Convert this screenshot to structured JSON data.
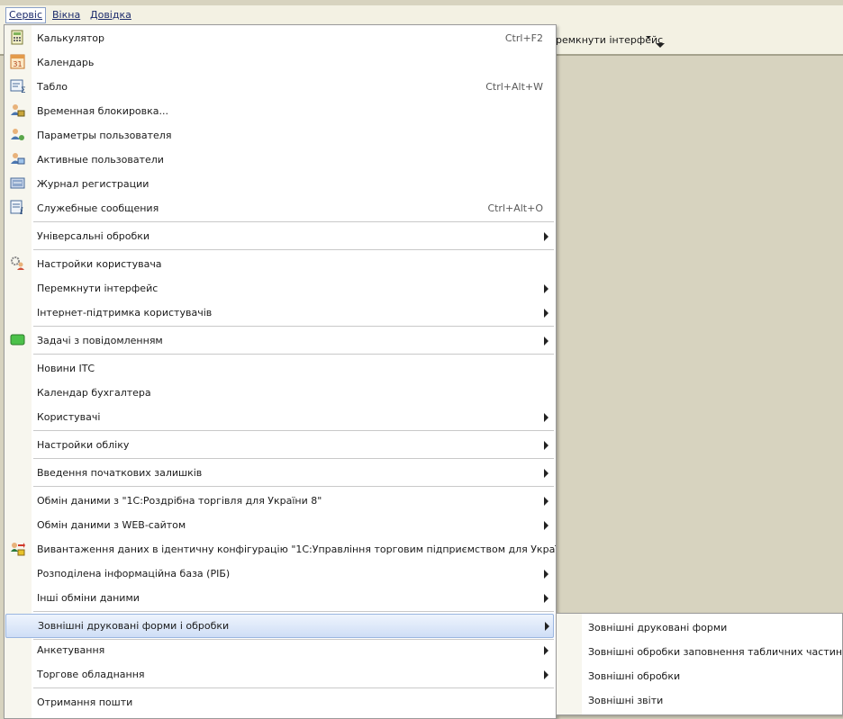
{
  "menubar": {
    "items": [
      "Сервіс",
      "Вікна",
      "Довідка"
    ]
  },
  "toolbar": {
    "partial_text": "ремкнути інтерфейс"
  },
  "menu": {
    "items": [
      {
        "label": "Калькулятор",
        "shortcut": "Ctrl+F2",
        "icon": "calculator-icon"
      },
      {
        "label": "Календарь",
        "shortcut": "",
        "icon": "calendar-icon",
        "icon_text": "31"
      },
      {
        "label": "Табло",
        "shortcut": "Ctrl+Alt+W",
        "icon": "tablo-icon"
      },
      {
        "label": "Временная блокировка...",
        "shortcut": "",
        "icon": "user-lock-icon"
      },
      {
        "label": "Параметры пользователя",
        "shortcut": "",
        "icon": "user-settings-icon"
      },
      {
        "label": "Активные пользователи",
        "shortcut": "",
        "icon": "active-users-icon"
      },
      {
        "label": "Журнал регистрации",
        "shortcut": "",
        "icon": "journal-icon"
      },
      {
        "label": "Служебные сообщения",
        "shortcut": "Ctrl+Alt+O",
        "icon": "messages-icon"
      },
      {
        "label": "Універсальні обробки"
      },
      {
        "label": "Настройки користувача",
        "icon": "user-gear-icon"
      },
      {
        "label": "Перемкнути інтерфейс"
      },
      {
        "label": "Інтернет-підтримка користувачів"
      },
      {
        "label": "Задачі з повідомленням",
        "icon": "task-message-icon"
      },
      {
        "label": "Новини ІТС"
      },
      {
        "label": "Календар бухгалтера"
      },
      {
        "label": "Користувачі"
      },
      {
        "label": "Настройки обліку"
      },
      {
        "label": "Введення початкових залишків"
      },
      {
        "label": "Обмін даними з \"1С:Роздрібна торгівля для України 8\""
      },
      {
        "label": "Обмін даними з WEB-сайтом"
      },
      {
        "label": "Вивантаження даних в ідентичну конфігурацію \"1С:Управління торговим підприємством для України\"",
        "icon": "export-icon"
      },
      {
        "label": "Розподілена інформаційна база (РІБ)"
      },
      {
        "label": "Інші обміни даними"
      },
      {
        "label": "Зовнішні друковані форми і обробки"
      },
      {
        "label": "Анкетування"
      },
      {
        "label": "Торгове обладнання"
      },
      {
        "label": "Отримання пошти"
      }
    ]
  },
  "submenu": {
    "items": [
      "Зовнішні друковані форми",
      "Зовнішні обробки заповнення табличних частин",
      "Зовнішні обробки",
      "Зовнішні звіти"
    ]
  },
  "colors": {
    "background": "#d7d3bf",
    "menubar": "#f3f1e3",
    "highlight": "#cfdef6",
    "link": "#1b2a6b"
  }
}
